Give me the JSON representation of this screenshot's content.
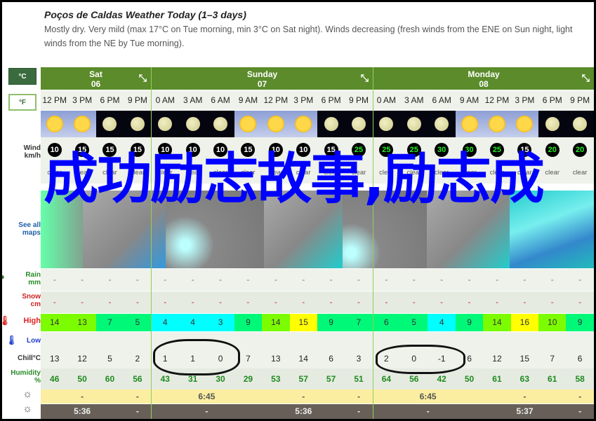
{
  "intro": {
    "title": "Poços de Caldas Weather Today (1–3 days)",
    "summary": "Mostly dry. Very mild (max 17°C on Tue morning, min 3°C on Sat night). Winds decreasing (fresh winds from the ENE on Sun night, light winds from the NE by Tue morning)."
  },
  "units": {
    "celsius": "°C",
    "fahrenheit": "°F"
  },
  "labels": {
    "wind": "Wind",
    "wind_unit": "km/h",
    "see_all": "See all",
    "maps": "maps",
    "rain": "Rain",
    "rain_unit": "mm",
    "snow": "Snow",
    "snow_unit": "cm",
    "high": "High",
    "low": "Low",
    "chill": "Chill°C",
    "humidity": "Humidity",
    "humidity_unit": "%"
  },
  "days": [
    {
      "name": "Sat",
      "date": "06"
    },
    {
      "name": "Sunday",
      "date": "07"
    },
    {
      "name": "Monday",
      "date": "08"
    }
  ],
  "times": [
    "12 PM",
    "3 PM",
    "6 PM",
    "9 PM",
    "0 AM",
    "3 AM",
    "6 AM",
    "9 AM",
    "12 PM",
    "3 PM",
    "6 PM",
    "9 PM",
    "0 AM",
    "3 AM",
    "6 AM",
    "9 AM",
    "12 PM",
    "3 PM",
    "6 PM",
    "9 PM"
  ],
  "icons": [
    "sun",
    "sun",
    "moon",
    "moon",
    "moon",
    "moon",
    "moon",
    "sun",
    "sun",
    "sun",
    "moon",
    "moon",
    "moon",
    "moon",
    "moon",
    "sun",
    "sun",
    "sun",
    "moon",
    "moon"
  ],
  "wind": [
    {
      "speed": "10",
      "color": "#ffffff"
    },
    {
      "speed": "15",
      "color": "#ffffff"
    },
    {
      "speed": "15",
      "color": "#ffffff"
    },
    {
      "speed": "15",
      "color": "#ffffff"
    },
    {
      "speed": "10",
      "color": "#ffffff"
    },
    {
      "speed": "10",
      "color": "#ffffff"
    },
    {
      "speed": "10",
      "color": "#ffffff"
    },
    {
      "speed": "15",
      "color": "#ffffff"
    },
    {
      "speed": "10",
      "color": "#ffffff"
    },
    {
      "speed": "10",
      "color": "#ffffff"
    },
    {
      "speed": "15",
      "color": "#ffffff"
    },
    {
      "speed": "25",
      "color": "#22ee22"
    },
    {
      "speed": "25",
      "color": "#22ee22"
    },
    {
      "speed": "25",
      "color": "#22ee22"
    },
    {
      "speed": "30",
      "color": "#22ee22"
    },
    {
      "speed": "30",
      "color": "#22ee22"
    },
    {
      "speed": "25",
      "color": "#22ee22"
    },
    {
      "speed": "15",
      "color": "#ffffff"
    },
    {
      "speed": "20",
      "color": "#22ee22"
    },
    {
      "speed": "20",
      "color": "#22ee22"
    }
  ],
  "conditions": [
    "clear",
    "clear",
    "clear",
    "clear",
    "clear",
    "clear",
    "clear",
    "clear",
    "clear",
    "clear",
    "clear",
    "clear",
    "clear",
    "clear",
    "clear",
    "clear",
    "clear",
    "clear",
    "clear",
    "clear"
  ],
  "rain": [
    "-",
    "-",
    "-",
    "-",
    "-",
    "-",
    "-",
    "-",
    "-",
    "-",
    "-",
    "-",
    "-",
    "-",
    "-",
    "-",
    "-",
    "-",
    "-",
    "-"
  ],
  "snow": [
    "-",
    "-",
    "-",
    "-",
    "-",
    "-",
    "-",
    "-",
    "-",
    "-",
    "-",
    "-",
    "-",
    "-",
    "-",
    "-",
    "-",
    "-",
    "-",
    "-"
  ],
  "high": [
    {
      "v": "14",
      "c": "#7cfc00"
    },
    {
      "v": "13",
      "c": "#7cfc00"
    },
    {
      "v": "7",
      "c": "#00f878"
    },
    {
      "v": "5",
      "c": "#00f878"
    },
    {
      "v": "4",
      "c": "#00ffff"
    },
    {
      "v": "4",
      "c": "#00ffff"
    },
    {
      "v": "3",
      "c": "#00ffff"
    },
    {
      "v": "9",
      "c": "#00f878"
    },
    {
      "v": "14",
      "c": "#7cfc00"
    },
    {
      "v": "15",
      "c": "#ffff00"
    },
    {
      "v": "9",
      "c": "#00f878"
    },
    {
      "v": "7",
      "c": "#00f878"
    },
    {
      "v": "6",
      "c": "#00f878"
    },
    {
      "v": "5",
      "c": "#00f878"
    },
    {
      "v": "4",
      "c": "#00ffff"
    },
    {
      "v": "9",
      "c": "#00f878"
    },
    {
      "v": "14",
      "c": "#7cfc00"
    },
    {
      "v": "16",
      "c": "#ffff00"
    },
    {
      "v": "10",
      "c": "#7cfc00"
    },
    {
      "v": "9",
      "c": "#00f878"
    }
  ],
  "chill": [
    "13",
    "12",
    "5",
    "2",
    "1",
    "1",
    "0",
    "7",
    "13",
    "14",
    "6",
    "3",
    "2",
    "0",
    "-1",
    "6",
    "12",
    "15",
    "7",
    "6"
  ],
  "humidity": [
    "46",
    "50",
    "60",
    "56",
    "43",
    "31",
    "30",
    "29",
    "53",
    "57",
    "57",
    "51",
    "64",
    "56",
    "42",
    "50",
    "61",
    "63",
    "61",
    "58"
  ],
  "sunrise": [
    {
      "col": 1,
      "v": "-"
    },
    {
      "col": 3,
      "v": "-"
    },
    {
      "col": 5.5,
      "v": "6:45"
    },
    {
      "col": 9,
      "v": "-"
    },
    {
      "col": 11,
      "v": "-"
    },
    {
      "col": 13.5,
      "v": "6:45"
    },
    {
      "col": 17,
      "v": "-"
    },
    {
      "col": 19,
      "v": "-"
    }
  ],
  "sunset": [
    {
      "col": 1,
      "v": "5:36"
    },
    {
      "col": 3,
      "v": "-"
    },
    {
      "col": 5.5,
      "v": "-"
    },
    {
      "col": 9,
      "v": "5:36"
    },
    {
      "col": 11,
      "v": "-"
    },
    {
      "col": 13.5,
      "v": "-"
    },
    {
      "col": 17,
      "v": "5:37"
    },
    {
      "col": 19,
      "v": "-"
    }
  ],
  "overlay_text": "成功励志故事,励志成"
}
